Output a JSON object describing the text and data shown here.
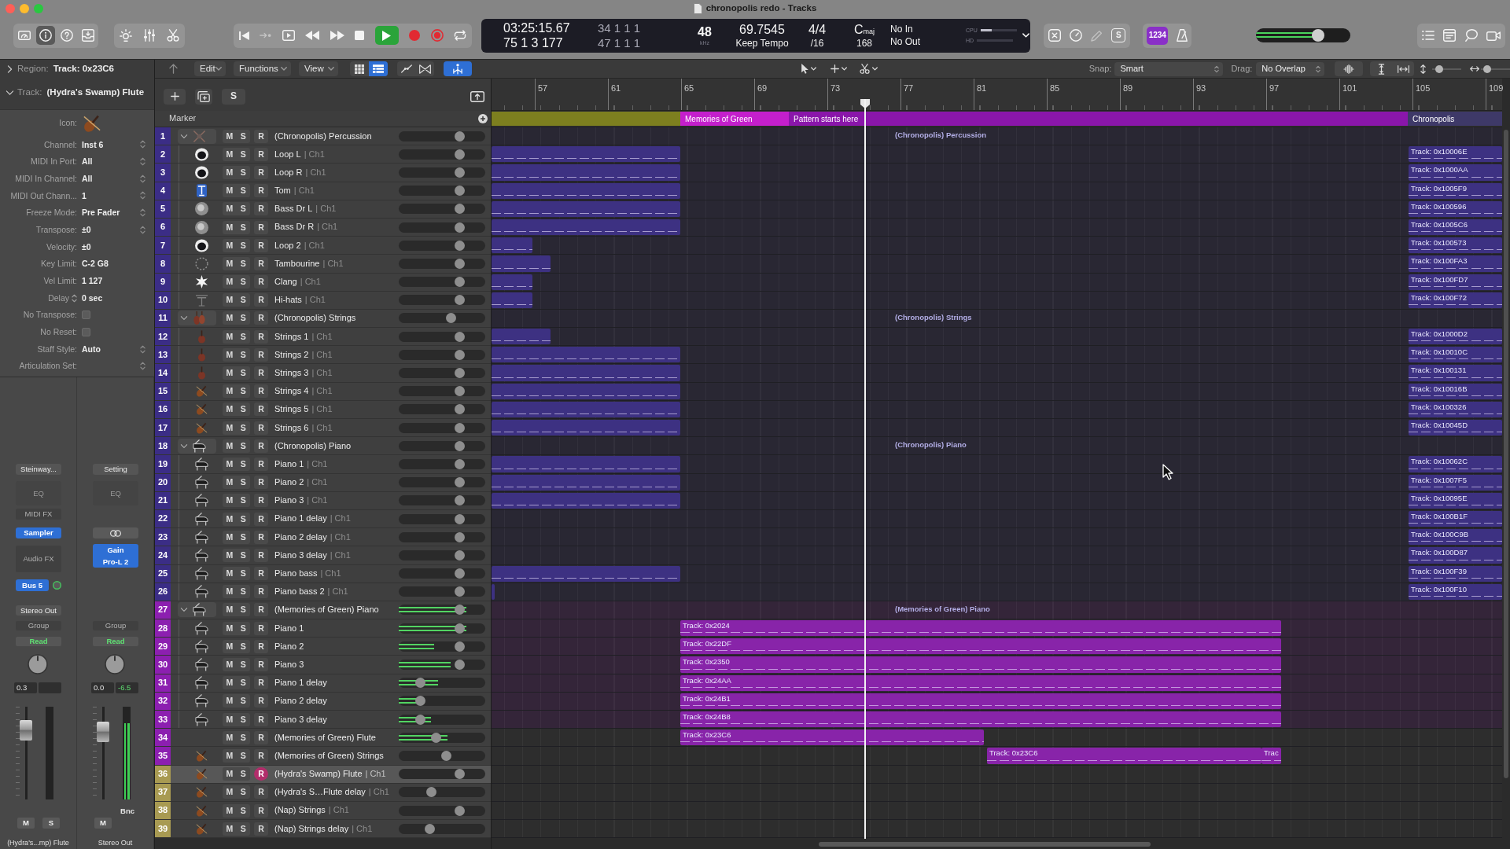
{
  "window": {
    "title": "chronopolis redo - Tracks"
  },
  "toolbar": {
    "view_buttons": [
      {
        "selected": false
      },
      {
        "selected": true
      },
      {
        "selected": false
      },
      {
        "selected": false
      }
    ],
    "transport": {
      "playing": true
    },
    "lcd": {
      "time": "03:25:15.67",
      "bars": "75 1 3 177",
      "left_locator": "34 1 1 1",
      "right_locator": "47 1 1 1",
      "sample_rate": "48",
      "sample_rate_unit": "kHz",
      "tempo": "69.7545",
      "tempo_mode": "Keep Tempo",
      "signature": "4/4",
      "division": "/16",
      "key": "C",
      "key_mode": "maj",
      "key_value": "168",
      "midi_in": "No In",
      "midi_out": "No Out",
      "cpu": {
        "label": "CPU",
        "level": 0.3
      },
      "hd": {
        "label": "HD"
      }
    },
    "mode_button": {
      "label": "S"
    },
    "count_in": {
      "label": "1234",
      "on": true
    },
    "master_volume": {
      "level": 0.66
    }
  },
  "inspector": {
    "region": {
      "label": "Region:",
      "value": "Track: 0x23C6",
      "expanded": false
    },
    "track": {
      "label": "Track:",
      "value": "(Hydra's Swamp) Flute",
      "expanded": true
    },
    "params": [
      {
        "kind": "icon",
        "label": "Icon:"
      },
      {
        "kind": "menu",
        "label": "Channel:",
        "value": "Inst 6"
      },
      {
        "kind": "menu",
        "label": "MIDI In Port:",
        "value": "All"
      },
      {
        "kind": "menu",
        "label": "MIDI In Channel:",
        "value": "All"
      },
      {
        "kind": "menu",
        "label": "MIDI Out Chann...",
        "value": "1"
      },
      {
        "kind": "menu",
        "label": "Freeze Mode:",
        "value": "Pre Fader"
      },
      {
        "kind": "menu",
        "label": "Transpose:",
        "value": "±0"
      },
      {
        "kind": "text",
        "label": "Velocity:",
        "value": "±0"
      },
      {
        "kind": "text",
        "label": "Key Limit:",
        "value": "C-2 G8"
      },
      {
        "kind": "text",
        "label": "Vel Limit:",
        "value": "1 127"
      },
      {
        "kind": "stepper",
        "label": "Delay",
        "value": "0 sec"
      },
      {
        "kind": "checkbox",
        "label": "No Transpose:",
        "checked": false
      },
      {
        "kind": "checkbox",
        "label": "No Reset:",
        "checked": false
      },
      {
        "kind": "menu",
        "label": "Staff Style:",
        "value": "Auto"
      },
      {
        "kind": "menu",
        "label": "Articulation Set:"
      }
    ]
  },
  "strips": [
    {
      "setting": "Steinway...",
      "eq": "EQ",
      "slots": [
        {
          "kind": "empty",
          "label": "MIDI FX"
        },
        {
          "kind": "plugin",
          "label": "Sampler"
        },
        {
          "kind": "empty",
          "label": "Audio FX"
        }
      ],
      "send": "Bus 5",
      "output": "Stereo Out",
      "group": "Group",
      "automation": "Read",
      "volume_value": "0.3",
      "fader": {
        "level": 0.75
      },
      "buttons": [
        {
          "label": "M",
          "on": false
        },
        {
          "label": "S",
          "on": false
        }
      ],
      "name": "(Hydra's...mp) Flute"
    },
    {
      "setting": "Setting",
      "eq": "EQ",
      "slots": [
        {
          "kind": "link"
        },
        {
          "kind": "plugin",
          "label": "Gain"
        },
        {
          "kind": "plugin",
          "label": "Pro-L 2"
        }
      ],
      "group": "Group",
      "automation": "Read",
      "volume_value": "0.0",
      "peak_value": "-6.5",
      "fader": {
        "level": 0.73
      },
      "meter": {
        "level": 0.82
      },
      "bounce": "Bnc",
      "buttons": [
        {
          "label": "M",
          "on": false
        }
      ],
      "name": "Stereo Out"
    }
  ],
  "tracks_toolbar": {
    "menus": [
      "Edit",
      "Functions",
      "View"
    ],
    "view_toggles": [
      {
        "on": false
      },
      {
        "on": true
      }
    ],
    "mode_toggles": [
      {
        "on": false
      },
      {
        "on": false
      }
    ],
    "catch_button": {
      "on": true
    },
    "snap": {
      "label": "Snap:",
      "value": "Smart"
    },
    "drag": {
      "label": "Drag:",
      "value": "No Overlap"
    },
    "vertical_zoom": {
      "level": 0.24
    },
    "horizontal_zoom": {
      "level": 0.22
    }
  },
  "track_header": {
    "solo_label": "S",
    "marker_label": "Marker"
  },
  "ruler": [
    "57",
    "61",
    "65",
    "69",
    "73",
    "77",
    "81",
    "85",
    "89",
    "93",
    "97",
    "101",
    "105",
    "109"
  ],
  "markers": [
    {
      "kind": "lead",
      "color": "#7d7f1f"
    },
    {
      "label": "Memories of Green",
      "kind": "section",
      "color": "#c41fcc"
    },
    {
      "label": "Pattern starts here",
      "kind": "pattern",
      "color": "#8a16aa"
    },
    {
      "label": "Chronopolis",
      "kind": "tail",
      "color": "#3e3968"
    }
  ],
  "tracks": [
    {
      "number": "1",
      "name": "(Chronopolis) Percussion",
      "kind": "kit",
      "color": "#3b2d86",
      "expanded": true,
      "selected": false,
      "buttons": [
        {
          "label": "M",
          "on": false
        },
        {
          "label": "S",
          "on": false
        },
        {
          "label": "R",
          "on": false
        }
      ],
      "volume": {
        "level": 0.7
      },
      "lane_label": "(Chronopolis) Percussion",
      "children": [
        {
          "number": "2",
          "name": "Loop L",
          "channel": "| Ch1",
          "kind": "drum",
          "color": "#3b2d86",
          "selected": false,
          "buttons": [
            {
              "label": "M",
              "on": false
            },
            {
              "label": "S",
              "on": false
            },
            {
              "label": "R",
              "on": false
            }
          ],
          "volume": {
            "level": 0.7
          },
          "regions": [
            {
              "kind": "head"
            },
            {
              "kind": "tail",
              "label": "Track: 0x10006E"
            }
          ]
        },
        {
          "number": "3",
          "name": "Loop R",
          "channel": "| Ch1",
          "kind": "drum",
          "color": "#3b2d86",
          "selected": false,
          "buttons": [
            {
              "label": "M",
              "on": false
            },
            {
              "label": "S",
              "on": false
            },
            {
              "label": "R",
              "on": false
            }
          ],
          "volume": {
            "level": 0.7
          },
          "regions": [
            {
              "kind": "head"
            },
            {
              "kind": "tail",
              "label": "Track: 0x1000AA"
            }
          ]
        },
        {
          "number": "4",
          "name": "Tom",
          "channel": "| Ch1",
          "kind": "tom",
          "color": "#3b2d86",
          "selected": false,
          "buttons": [
            {
              "label": "M",
              "on": false
            },
            {
              "label": "S",
              "on": false
            },
            {
              "label": "R",
              "on": false
            }
          ],
          "volume": {
            "level": 0.7
          },
          "regions": [
            {
              "kind": "head"
            },
            {
              "kind": "tail",
              "label": "Track: 0x1005F9"
            }
          ]
        },
        {
          "number": "5",
          "name": "Bass Dr L",
          "channel": "| Ch1",
          "kind": "kick",
          "color": "#3b2d86",
          "selected": false,
          "buttons": [
            {
              "label": "M",
              "on": false
            },
            {
              "label": "S",
              "on": false
            },
            {
              "label": "R",
              "on": false
            }
          ],
          "volume": {
            "level": 0.7
          },
          "regions": [
            {
              "kind": "head"
            },
            {
              "kind": "tail",
              "label": "Track: 0x100596"
            }
          ]
        },
        {
          "number": "6",
          "name": "Bass Dr R",
          "channel": "| Ch1",
          "kind": "kick",
          "color": "#3b2d86",
          "selected": false,
          "buttons": [
            {
              "label": "M",
              "on": false
            },
            {
              "label": "S",
              "on": false
            },
            {
              "label": "R",
              "on": false
            }
          ],
          "volume": {
            "level": 0.7
          },
          "regions": [
            {
              "kind": "head"
            },
            {
              "kind": "tail",
              "label": "Track: 0x1005C6"
            }
          ]
        },
        {
          "number": "7",
          "name": "Loop 2",
          "channel": "| Ch1",
          "kind": "drum",
          "color": "#3b2d86",
          "selected": false,
          "buttons": [
            {
              "label": "M",
              "on": false
            },
            {
              "label": "S",
              "on": false
            },
            {
              "label": "R",
              "on": false
            }
          ],
          "volume": {
            "level": 0.7
          },
          "regions": [
            {
              "kind": "short"
            },
            {
              "kind": "tail",
              "label": "Track: 0x100573"
            }
          ]
        },
        {
          "number": "8",
          "name": "Tambourine",
          "channel": "| Ch1",
          "kind": "tambourine",
          "color": "#3b2d86",
          "selected": false,
          "buttons": [
            {
              "label": "M",
              "on": false
            },
            {
              "label": "S",
              "on": false
            },
            {
              "label": "R",
              "on": false
            }
          ],
          "volume": {
            "level": 0.7
          },
          "regions": [
            {
              "kind": "mid"
            },
            {
              "kind": "tail",
              "label": "Track: 0x100FA3"
            }
          ]
        },
        {
          "number": "9",
          "name": "Clang",
          "channel": "| Ch1",
          "kind": "burst",
          "color": "#3b2d86",
          "selected": false,
          "buttons": [
            {
              "label": "M",
              "on": false
            },
            {
              "label": "S",
              "on": false
            },
            {
              "label": "R",
              "on": false
            }
          ],
          "volume": {
            "level": 0.7
          },
          "regions": [
            {
              "kind": "short"
            },
            {
              "kind": "tail",
              "label": "Track: 0x100FD7"
            }
          ]
        },
        {
          "number": "10",
          "name": "Hi-hats",
          "channel": "| Ch1",
          "kind": "hihat",
          "color": "#3b2d86",
          "selected": false,
          "buttons": [
            {
              "label": "M",
              "on": false
            },
            {
              "label": "S",
              "on": false
            },
            {
              "label": "R",
              "on": false
            }
          ],
          "volume": {
            "level": 0.7
          },
          "regions": [
            {
              "kind": "short"
            },
            {
              "kind": "tail",
              "label": "Track: 0x100F72"
            }
          ]
        }
      ]
    },
    {
      "number": "11",
      "name": "(Chronopolis) Strings",
      "kind": "section",
      "color": "#3b2d86",
      "expanded": true,
      "selected": false,
      "buttons": [
        {
          "label": "M",
          "on": false
        },
        {
          "label": "S",
          "on": false
        },
        {
          "label": "R",
          "on": false
        }
      ],
      "volume": {
        "level": 0.6
      },
      "lane_label": "(Chronopolis) Strings",
      "children": [
        {
          "number": "12",
          "name": "Strings 1",
          "channel": "| Ch1",
          "kind": "violin",
          "color": "#3b2d86",
          "selected": false,
          "buttons": [
            {
              "label": "M",
              "on": false
            },
            {
              "label": "S",
              "on": false
            },
            {
              "label": "R",
              "on": false
            }
          ],
          "volume": {
            "level": 0.7
          },
          "regions": [
            {
              "kind": "mid"
            },
            {
              "kind": "tail",
              "label": "Track: 0x1000D2"
            }
          ]
        },
        {
          "number": "13",
          "name": "Strings 2",
          "channel": "| Ch1",
          "kind": "violin",
          "color": "#3b2d86",
          "selected": false,
          "buttons": [
            {
              "label": "M",
              "on": false
            },
            {
              "label": "S",
              "on": false
            },
            {
              "label": "R",
              "on": false
            }
          ],
          "volume": {
            "level": 0.7
          },
          "regions": [
            {
              "kind": "head"
            },
            {
              "kind": "tail",
              "label": "Track: 0x10010C"
            }
          ]
        },
        {
          "number": "14",
          "name": "Strings 3",
          "channel": "| Ch1",
          "kind": "violin",
          "color": "#3b2d86",
          "selected": false,
          "buttons": [
            {
              "label": "M",
              "on": false
            },
            {
              "label": "S",
              "on": false
            },
            {
              "label": "R",
              "on": false
            }
          ],
          "volume": {
            "level": 0.7
          },
          "regions": [
            {
              "kind": "head"
            },
            {
              "kind": "tail",
              "label": "Track: 0x100131"
            }
          ]
        },
        {
          "number": "15",
          "name": "Strings 4",
          "channel": "| Ch1",
          "kind": "fiddle",
          "color": "#3b2d86",
          "selected": false,
          "buttons": [
            {
              "label": "M",
              "on": false
            },
            {
              "label": "S",
              "on": false
            },
            {
              "label": "R",
              "on": false
            }
          ],
          "volume": {
            "level": 0.7
          },
          "regions": [
            {
              "kind": "head"
            },
            {
              "kind": "tail",
              "label": "Track: 0x10016B"
            }
          ]
        },
        {
          "number": "16",
          "name": "Strings 5",
          "channel": "| Ch1",
          "kind": "fiddle",
          "color": "#3b2d86",
          "selected": false,
          "buttons": [
            {
              "label": "M",
              "on": false
            },
            {
              "label": "S",
              "on": false
            },
            {
              "label": "R",
              "on": false
            }
          ],
          "volume": {
            "level": 0.7
          },
          "regions": [
            {
              "kind": "head"
            },
            {
              "kind": "tail",
              "label": "Track: 0x100326"
            }
          ]
        },
        {
          "number": "17",
          "name": "Strings 6",
          "channel": "| Ch1",
          "kind": "fiddle",
          "color": "#3b2d86",
          "selected": false,
          "buttons": [
            {
              "label": "M",
              "on": false
            },
            {
              "label": "S",
              "on": false
            },
            {
              "label": "R",
              "on": false
            }
          ],
          "volume": {
            "level": 0.7
          },
          "regions": [
            {
              "kind": "head"
            },
            {
              "kind": "tail",
              "label": "Track: 0x10045D"
            }
          ]
        }
      ]
    },
    {
      "number": "18",
      "name": "(Chronopolis) Piano",
      "kind": "piano",
      "color": "#3b2d86",
      "expanded": true,
      "selected": false,
      "buttons": [
        {
          "label": "M",
          "on": false
        },
        {
          "label": "S",
          "on": false
        },
        {
          "label": "R",
          "on": false
        }
      ],
      "volume": {
        "level": 0.7
      },
      "lane_label": "(Chronopolis) Piano",
      "children": [
        {
          "number": "19",
          "name": "Piano 1",
          "channel": "| Ch1",
          "kind": "piano",
          "color": "#3b2d86",
          "selected": false,
          "buttons": [
            {
              "label": "M",
              "on": false
            },
            {
              "label": "S",
              "on": false
            },
            {
              "label": "R",
              "on": false
            }
          ],
          "volume": {
            "level": 0.7
          },
          "regions": [
            {
              "kind": "head"
            },
            {
              "kind": "tail",
              "label": "Track: 0x10062C"
            }
          ]
        },
        {
          "number": "20",
          "name": "Piano 2",
          "channel": "| Ch1",
          "kind": "piano",
          "color": "#3b2d86",
          "selected": false,
          "buttons": [
            {
              "label": "M",
              "on": false
            },
            {
              "label": "S",
              "on": false
            },
            {
              "label": "R",
              "on": false
            }
          ],
          "volume": {
            "level": 0.7
          },
          "regions": [
            {
              "kind": "head"
            },
            {
              "kind": "tail",
              "label": "Track: 0x1007F5"
            }
          ]
        },
        {
          "number": "21",
          "name": "Piano 3",
          "channel": "| Ch1",
          "kind": "piano",
          "color": "#3b2d86",
          "selected": false,
          "buttons": [
            {
              "label": "M",
              "on": false
            },
            {
              "label": "S",
              "on": false
            },
            {
              "label": "R",
              "on": false
            }
          ],
          "volume": {
            "level": 0.7
          },
          "regions": [
            {
              "kind": "head"
            },
            {
              "kind": "tail",
              "label": "Track: 0x10095E"
            }
          ]
        },
        {
          "number": "22",
          "name": "Piano 1 delay",
          "channel": "| Ch1",
          "kind": "piano",
          "color": "#3b2d86",
          "selected": false,
          "buttons": [
            {
              "label": "M",
              "on": false
            },
            {
              "label": "S",
              "on": false
            },
            {
              "label": "R",
              "on": false
            }
          ],
          "volume": {
            "level": 0.7
          },
          "regions": [
            {
              "kind": "tail",
              "label": "Track: 0x100B1F"
            }
          ]
        },
        {
          "number": "23",
          "name": "Piano 2 delay",
          "channel": "| Ch1",
          "kind": "piano",
          "color": "#3b2d86",
          "selected": false,
          "buttons": [
            {
              "label": "M",
              "on": false
            },
            {
              "label": "S",
              "on": false
            },
            {
              "label": "R",
              "on": false
            }
          ],
          "volume": {
            "level": 0.7
          },
          "regions": [
            {
              "kind": "tail",
              "label": "Track: 0x100C9B"
            }
          ]
        },
        {
          "number": "24",
          "name": "Piano 3 delay",
          "channel": "| Ch1",
          "kind": "piano",
          "color": "#3b2d86",
          "selected": false,
          "buttons": [
            {
              "label": "M",
              "on": false
            },
            {
              "label": "S",
              "on": false
            },
            {
              "label": "R",
              "on": false
            }
          ],
          "volume": {
            "level": 0.7
          },
          "regions": [
            {
              "kind": "tail",
              "label": "Track: 0x100D87"
            }
          ]
        },
        {
          "number": "25",
          "name": "Piano bass",
          "channel": "| Ch1",
          "kind": "piano",
          "color": "#3b2d86",
          "selected": false,
          "buttons": [
            {
              "label": "M",
              "on": false
            },
            {
              "label": "S",
              "on": false
            },
            {
              "label": "R",
              "on": false
            }
          ],
          "volume": {
            "level": 0.7
          },
          "regions": [
            {
              "kind": "head"
            },
            {
              "kind": "tail",
              "label": "Track: 0x100F39"
            }
          ]
        },
        {
          "number": "26",
          "name": "Piano bass 2",
          "channel": "| Ch1",
          "kind": "piano",
          "color": "#3b2d86",
          "selected": false,
          "buttons": [
            {
              "label": "M",
              "on": false
            },
            {
              "label": "S",
              "on": false
            },
            {
              "label": "R",
              "on": false
            }
          ],
          "volume": {
            "level": 0.7
          },
          "regions": [
            {
              "kind": "stub"
            },
            {
              "kind": "tail",
              "label": "Track: 0x100F10"
            }
          ]
        }
      ]
    },
    {
      "number": "27",
      "name": "(Memories of Green) Piano",
      "kind": "piano",
      "color": "#8c1fb0",
      "expanded": true,
      "selected": false,
      "buttons": [
        {
          "label": "M",
          "on": false
        },
        {
          "label": "S",
          "on": false
        },
        {
          "label": "R",
          "on": false
        }
      ],
      "volume": {
        "level": 0.7
      },
      "meter": {
        "level": 0.78
      },
      "lane_label": "(Memories of Green) Piano",
      "children": [
        {
          "number": "28",
          "name": "Piano 1",
          "kind": "piano",
          "color": "#8c1fb0",
          "selected": false,
          "buttons": [
            {
              "label": "M",
              "on": false
            },
            {
              "label": "S",
              "on": false
            },
            {
              "label": "R",
              "on": false
            }
          ],
          "volume": {
            "level": 0.7
          },
          "meter": {
            "level": 0.78
          },
          "regions": [
            {
              "kind": "main",
              "label": "Track: 0x2024"
            }
          ]
        },
        {
          "number": "29",
          "name": "Piano 2",
          "kind": "piano",
          "color": "#8c1fb0",
          "selected": false,
          "buttons": [
            {
              "label": "M",
              "on": false
            },
            {
              "label": "S",
              "on": false
            },
            {
              "label": "R",
              "on": false
            }
          ],
          "volume": {
            "level": 0.7
          },
          "meter": {
            "level": 0.41
          },
          "regions": [
            {
              "kind": "main",
              "label": "Track: 0x22DF"
            }
          ]
        },
        {
          "number": "30",
          "name": "Piano 3",
          "kind": "piano",
          "color": "#8c1fb0",
          "selected": false,
          "buttons": [
            {
              "label": "M",
              "on": false
            },
            {
              "label": "S",
              "on": false
            },
            {
              "label": "R",
              "on": false
            }
          ],
          "volume": {
            "level": 0.7
          },
          "meter": {
            "level": 0.6
          },
          "regions": [
            {
              "kind": "main",
              "label": "Track: 0x2350"
            }
          ]
        },
        {
          "number": "31",
          "name": "Piano 1 delay",
          "kind": "piano",
          "color": "#8c1fb0",
          "selected": false,
          "buttons": [
            {
              "label": "M",
              "on": false
            },
            {
              "label": "S",
              "on": false
            },
            {
              "label": "R",
              "on": false
            }
          ],
          "volume": {
            "level": 0.25
          },
          "meter": {
            "level": 0.45
          },
          "regions": [
            {
              "kind": "main",
              "label": "Track: 0x24AA"
            }
          ]
        },
        {
          "number": "32",
          "name": "Piano 2 delay",
          "kind": "piano",
          "color": "#8c1fb0",
          "selected": false,
          "buttons": [
            {
              "label": "M",
              "on": false
            },
            {
              "label": "S",
              "on": false
            },
            {
              "label": "R",
              "on": false
            }
          ],
          "volume": {
            "level": 0.25
          },
          "meter": {
            "level": 0.3
          },
          "regions": [
            {
              "kind": "main",
              "label": "Track: 0x24B1"
            }
          ]
        },
        {
          "number": "33",
          "name": "Piano 3 delay",
          "kind": "piano",
          "color": "#8c1fb0",
          "selected": false,
          "buttons": [
            {
              "label": "M",
              "on": false
            },
            {
              "label": "S",
              "on": false
            },
            {
              "label": "R",
              "on": false
            }
          ],
          "volume": {
            "level": 0.25
          },
          "meter": {
            "level": 0.37
          },
          "regions": [
            {
              "kind": "main",
              "label": "Track: 0x24B8"
            }
          ]
        }
      ]
    },
    {
      "number": "34",
      "name": "(Memories of Green) Flute",
      "kind": "blank",
      "color": "#8c1fb0",
      "selected": false,
      "buttons": [
        {
          "label": "M",
          "on": false
        },
        {
          "label": "S",
          "on": false
        },
        {
          "label": "R",
          "on": false
        }
      ],
      "volume": {
        "level": 0.43
      },
      "meter": {
        "level": 0.56
      },
      "regions": [
        {
          "kind": "partial",
          "label": "Track: 0x23C6"
        }
      ]
    },
    {
      "number": "35",
      "name": "(Memories of Green) Strings",
      "kind": "fiddle",
      "color": "#8c1fb0",
      "selected": false,
      "buttons": [
        {
          "label": "M",
          "on": false
        },
        {
          "label": "S",
          "on": false
        },
        {
          "label": "R",
          "on": false
        }
      ],
      "volume": {
        "level": 0.55
      },
      "regions": [
        {
          "kind": "late",
          "label": "Track: 0x23C6"
        },
        {
          "kind": "end",
          "label": "Trac"
        }
      ]
    },
    {
      "number": "36",
      "name": "(Hydra's Swamp) Flute",
      "channel": "| Ch1",
      "kind": "fiddle",
      "color": "#a89a52",
      "selected": true,
      "buttons": [
        {
          "label": "M",
          "on": false
        },
        {
          "label": "S",
          "on": false
        },
        {
          "label": "R",
          "on": true
        }
      ],
      "volume": {
        "level": 0.7
      }
    },
    {
      "number": "37",
      "name": "(Hydra's S…Flute delay",
      "channel": "| Ch1",
      "kind": "fiddle",
      "color": "#a89a52",
      "selected": false,
      "buttons": [
        {
          "label": "M",
          "on": false
        },
        {
          "label": "S",
          "on": false
        },
        {
          "label": "R",
          "on": false
        }
      ],
      "volume": {
        "level": 0.38
      }
    },
    {
      "number": "38",
      "name": "(Nap) Strings",
      "channel": "| Ch1",
      "kind": "fiddle",
      "color": "#a89a52",
      "selected": false,
      "buttons": [
        {
          "label": "M",
          "on": false
        },
        {
          "label": "S",
          "on": false
        },
        {
          "label": "R",
          "on": false
        }
      ],
      "volume": {
        "level": 0.7
      }
    },
    {
      "number": "39",
      "name": "(Nap) Strings delay",
      "channel": "| Ch1",
      "kind": "fiddle",
      "color": "#a89a52",
      "selected": false,
      "buttons": [
        {
          "label": "M",
          "on": false
        },
        {
          "label": "S",
          "on": false
        },
        {
          "label": "R",
          "on": false
        }
      ],
      "volume": {
        "level": 0.36
      }
    }
  ]
}
